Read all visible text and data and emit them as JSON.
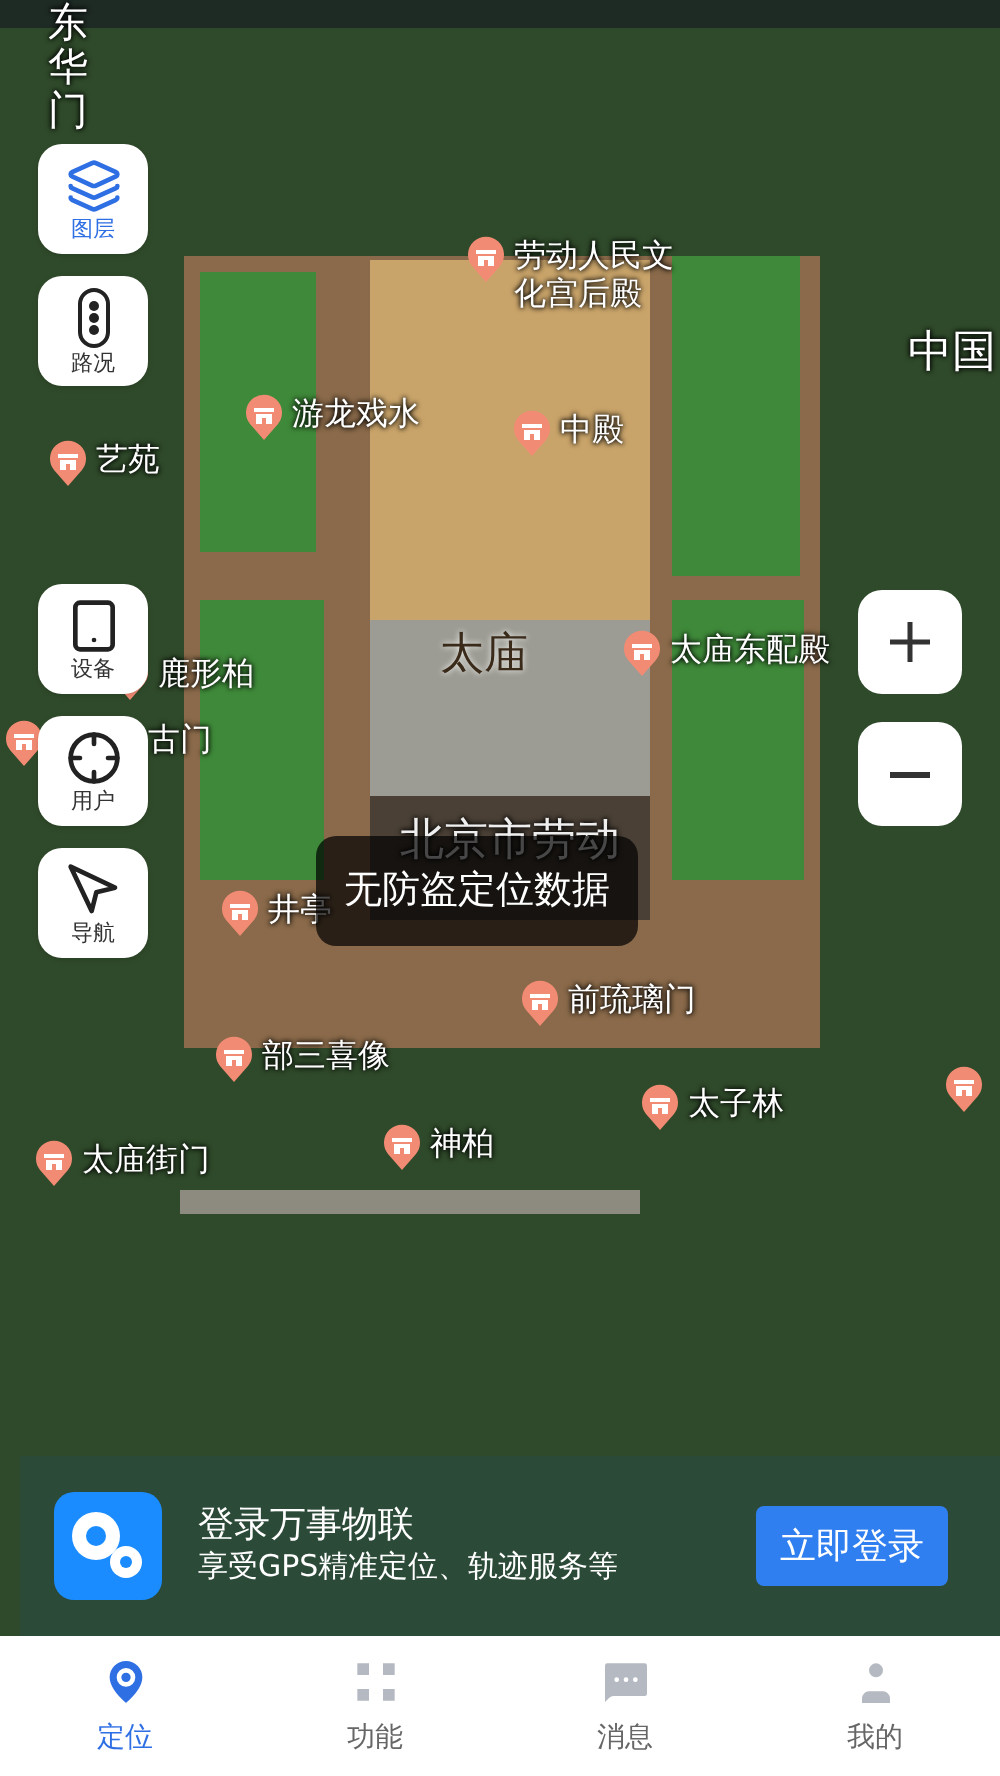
{
  "map": {
    "labels": [
      {
        "kind": "vertical",
        "text": "东华门"
      },
      {
        "kind": "poi",
        "text": "劳动人民文化宫后殿"
      },
      {
        "kind": "poi",
        "text": "游龙戏水"
      },
      {
        "kind": "poi",
        "text": "艺苑"
      },
      {
        "kind": "poi",
        "text": "中殿"
      },
      {
        "kind": "area",
        "text": "中国"
      },
      {
        "kind": "area",
        "text": "太庙"
      },
      {
        "kind": "poi",
        "text": "太庙东配殿"
      },
      {
        "kind": "poi",
        "text": "鹿形柏"
      },
      {
        "kind": "poi",
        "text": "古门"
      },
      {
        "kind": "faint",
        "text": "北京市劳动"
      },
      {
        "kind": "poi",
        "text": "井亭"
      },
      {
        "kind": "poi",
        "text": "前琉璃门"
      },
      {
        "kind": "poi",
        "text": "部三喜像"
      },
      {
        "kind": "poi",
        "text": "太子林"
      },
      {
        "kind": "poi",
        "text": "太庙街门"
      },
      {
        "kind": "poi",
        "text": "神柏"
      },
      {
        "kind": "pin"
      }
    ]
  },
  "side_buttons": [
    {
      "kind": "layers",
      "label": "图层",
      "selected": true
    },
    {
      "kind": "traffic",
      "label": "路况",
      "selected": false
    },
    {
      "kind": "device",
      "label": "设备",
      "selected": false
    },
    {
      "kind": "user",
      "label": "用户",
      "selected": false
    },
    {
      "kind": "navigate",
      "label": "导航",
      "selected": false
    }
  ],
  "toast": "无防盗定位数据",
  "login_banner": {
    "title": "登录万事物联",
    "subtitle": "享受GPS精准定位、轨迹服务等",
    "button": "立即登录"
  },
  "tabs": [
    {
      "kind": "locate",
      "label": "定位",
      "selected": true
    },
    {
      "kind": "apps",
      "label": "功能",
      "selected": false
    },
    {
      "kind": "message",
      "label": "消息",
      "selected": false
    },
    {
      "kind": "profile",
      "label": "我的",
      "selected": false
    }
  ]
}
